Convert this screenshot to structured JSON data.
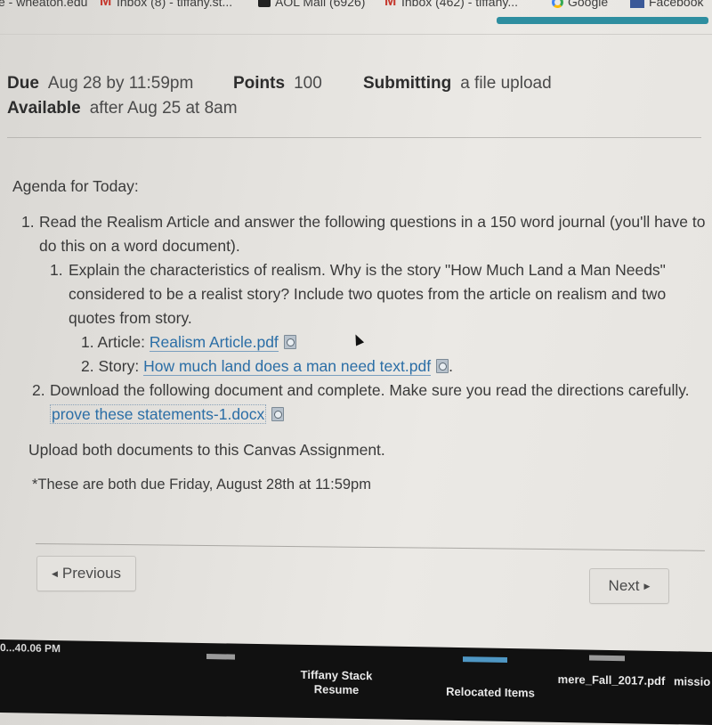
{
  "browser": {
    "bookmarks": [
      {
        "label": "e - wheaton.edu",
        "icon": "none"
      },
      {
        "label": "Inbox (8) - tiffany.st...",
        "icon": "gmail-icon"
      },
      {
        "label": "AOL Mail (6926)",
        "icon": "aol-icon"
      },
      {
        "label": "Inbox (462) - tiffany...",
        "icon": "gmail-icon"
      },
      {
        "label": "Google",
        "icon": "google-icon"
      },
      {
        "label": "Facebook",
        "icon": "facebook-icon"
      }
    ],
    "page_load_progress": 1.0,
    "progress_color": "#2e8ea0"
  },
  "assignment": {
    "due_label": "Due",
    "due_value": "Aug 28 by 11:59pm",
    "points_label": "Points",
    "points_value": "100",
    "submitting_label": "Submitting",
    "submitting_value": "a file upload",
    "available_label": "Available",
    "available_value": "after Aug 25 at 8am"
  },
  "description": {
    "heading": "Agenda for Today:",
    "item1": {
      "num": "1.",
      "text": "Read the Realism Article and answer the following questions in a 150 word journal (you'll have to do this on a word document).",
      "sub1": {
        "num": "1.",
        "text": "Explain the characteristics of realism. Why is the story \"How Much Land a Man Needs\" considered to be a realist story? Include two quotes from the article on realism and two quotes from story.",
        "article": {
          "num": "1.",
          "label": "Article:",
          "link": "Realism Article.pdf"
        },
        "story": {
          "num": "2.",
          "label": "Story:",
          "link": "How much land does a man need text.pdf",
          "suffix": "."
        }
      }
    },
    "item2": {
      "num": "2.",
      "text": "Download the following document and complete. Make sure you read the directions carefully.",
      "link": "prove these statements-1.docx"
    },
    "upload_note": "Upload both documents to this Canvas Assignment.",
    "due_note": "*These are both due Friday, August 28th at 11:59pm",
    "link_color": "#2b6ea6"
  },
  "footer": {
    "previous_label": "Previous",
    "next_label": "Next"
  },
  "desktop": {
    "clock": "0...40.06 PM",
    "items": [
      {
        "label": "Tiffany Stack\nResume"
      },
      {
        "label": "Relocated Items"
      },
      {
        "label": "mere_Fall_2017.pdf"
      },
      {
        "label": "missio"
      }
    ]
  }
}
